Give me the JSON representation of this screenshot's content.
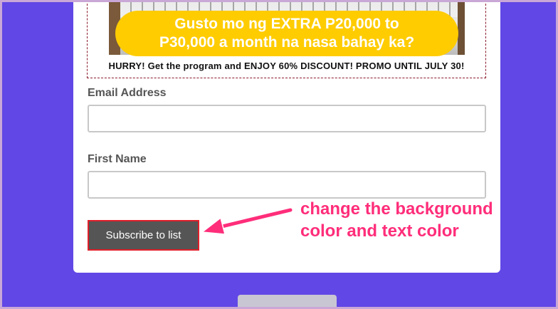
{
  "promo": {
    "headline_line1": "Gusto mo ng EXTRA P20,000 to",
    "headline_line2": "P30,000 a month na nasa bahay ka?",
    "note": "HURRY! Get the program and ENJOY 60% DISCOUNT! PROMO UNTIL JULY 30!"
  },
  "form": {
    "email_label": "Email Address",
    "email_value": "",
    "first_name_label": "First Name",
    "first_name_value": "",
    "subscribe_label": "Subscribe to list"
  },
  "annotation": {
    "line1": "change the background",
    "line2": "color and text color"
  },
  "colors": {
    "page_background": "#6147e6",
    "promo_pill": "#ffcc00",
    "button_background": "#555555",
    "button_border": "#e0202a",
    "annotation_text": "#ff2d7a"
  }
}
